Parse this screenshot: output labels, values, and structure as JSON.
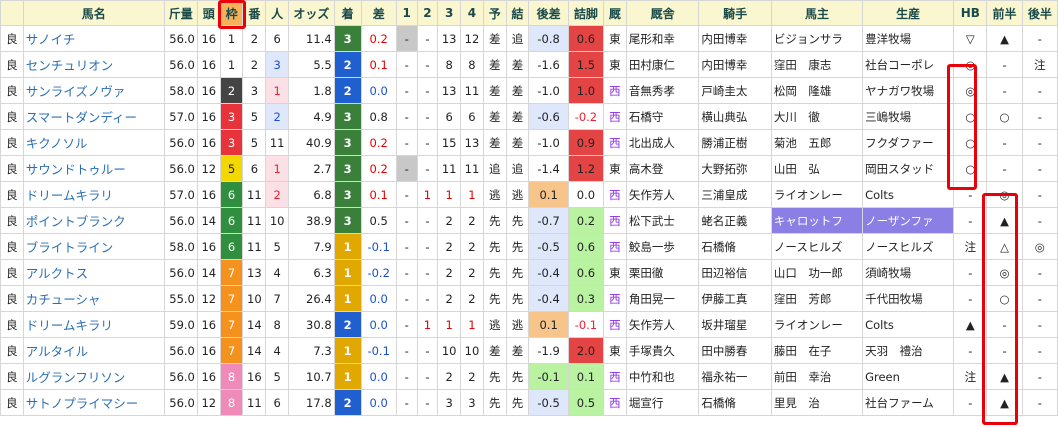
{
  "headers": [
    "",
    "馬名",
    "斤量",
    "頭",
    "枠",
    "番",
    "人",
    "オッズ",
    "着",
    "差",
    "1",
    "2",
    "3",
    "4",
    "予",
    "結",
    "後差",
    "詰脚",
    "厩",
    "厩舎",
    "騎手",
    "馬主",
    "生産",
    "HB",
    "前半",
    "後半"
  ],
  "colors": {
    "waku": {
      "1": "#ffffff",
      "2": "#444444",
      "3": "#e8333a",
      "4": "#2f6fcc",
      "5": "#f3d800",
      "6": "#2f8f3f",
      "7": "#f5921e",
      "8": "#f08ab8"
    },
    "chaku": {
      "1": "#e0a800",
      "2": "#1f5fd0",
      "3": "#3a7f3a",
      "4": "#555555",
      "5": "#b00000",
      "6": "#b00000",
      "7": "#b00000",
      "8": "#b00000",
      "9": "#b00000"
    },
    "pop_pink": "#fbe0e6",
    "pop_blue": "#dfe7fb",
    "go_green": "#b9f3a2",
    "go_orange": "#f7c48a",
    "tsume_red": "#e54444",
    "tsume_green": "#b9f3a2",
    "tsume_orange": "#f7c48a",
    "highlight_owner": "#8b7fe6",
    "header_bg": "#faf7d0"
  },
  "rows": [
    {
      "baba": "良",
      "name": "サノイチ",
      "kin": "56.0",
      "to": "16",
      "waku": "1",
      "ban": "2",
      "pop": "6",
      "popc": "",
      "odds": "11.4",
      "chaku": "3",
      "sa": "0.2",
      "sac": "pos",
      "p1": "-",
      "p1g": true,
      "p2": "-",
      "p3": "13",
      "p4": "12",
      "yo": "差",
      "ketsu": "追",
      "go": "-0.8",
      "goc": "blue",
      "tsume": "0.6",
      "tsumec": "red",
      "ew": "東",
      "stable": "尾形和幸",
      "jockey": "内田博幸",
      "owner": "ビジョンサラ",
      "ownc": "",
      "breeder": "豊洋牧場",
      "breedc": "",
      "hb": "▽",
      "zen": "▲",
      "kou": "-"
    },
    {
      "baba": "良",
      "name": "センチュリオン",
      "kin": "56.0",
      "to": "16",
      "waku": "1",
      "ban": "2",
      "pop": "3",
      "popc": "blue",
      "odds": "5.5",
      "chaku": "2",
      "sa": "0.1",
      "sac": "pos",
      "p1": "-",
      "p1g": false,
      "p2": "-",
      "p3": "8",
      "p4": "8",
      "yo": "差",
      "ketsu": "差",
      "go": "-1.6",
      "goc": "",
      "tsume": "1.5",
      "tsumec": "red",
      "ew": "東",
      "stable": "田村康仁",
      "jockey": "内田博幸",
      "owner": "窪田　康志",
      "ownc": "",
      "breeder": "社台コーポレ",
      "breedc": "",
      "hb": "◎",
      "zen": "-",
      "kou": "注"
    },
    {
      "baba": "良",
      "name": "サンライズノヴァ",
      "kin": "58.0",
      "to": "16",
      "waku": "2",
      "ban": "3",
      "pop": "1",
      "popc": "pink",
      "odds": "1.8",
      "chaku": "2",
      "sa": "0.0",
      "sac": "neg",
      "p1": "-",
      "p1g": false,
      "p2": "-",
      "p3": "13",
      "p4": "11",
      "yo": "差",
      "ketsu": "差",
      "go": "-1.0",
      "goc": "",
      "tsume": "1.0",
      "tsumec": "red",
      "ew": "西",
      "stable": "音無秀孝",
      "jockey": "戸崎圭太",
      "owner": "松岡　隆雄",
      "ownc": "",
      "breeder": "ヤナガワ牧場",
      "breedc": "",
      "hb": "◎",
      "zen": "-",
      "kou": "-"
    },
    {
      "baba": "良",
      "name": "スマートダンディー",
      "kin": "57.0",
      "to": "16",
      "waku": "3",
      "ban": "5",
      "pop": "2",
      "popc": "blue",
      "odds": "4.9",
      "chaku": "3",
      "sa": "0.8",
      "sac": "",
      "p1": "-",
      "p1g": false,
      "p2": "-",
      "p3": "6",
      "p4": "6",
      "yo": "差",
      "ketsu": "差",
      "go": "-0.6",
      "goc": "blue",
      "tsume": "-0.2",
      "tsumec": "",
      "ew": "西",
      "stable": "石橋守",
      "jockey": "横山典弘",
      "owner": "大川　徹",
      "ownc": "",
      "breeder": "三嶋牧場",
      "breedc": "",
      "hb": "○",
      "zen": "○",
      "kou": "-"
    },
    {
      "baba": "良",
      "name": "キクノソル",
      "kin": "56.0",
      "to": "16",
      "waku": "3",
      "ban": "5",
      "pop": "11",
      "popc": "",
      "odds": "40.9",
      "chaku": "3",
      "sa": "0.2",
      "sac": "pos",
      "p1": "-",
      "p1g": false,
      "p2": "-",
      "p3": "15",
      "p4": "13",
      "yo": "差",
      "ketsu": "差",
      "go": "-1.0",
      "goc": "",
      "tsume": "0.9",
      "tsumec": "red",
      "ew": "西",
      "stable": "北出成人",
      "jockey": "勝浦正樹",
      "owner": "菊池　五郎",
      "ownc": "",
      "breeder": "フクダファー",
      "breedc": "",
      "hb": "○",
      "zen": "-",
      "kou": "-"
    },
    {
      "baba": "良",
      "name": "サウンドトゥルー",
      "kin": "56.0",
      "to": "12",
      "waku": "5",
      "ban": "6",
      "pop": "1",
      "popc": "pink",
      "odds": "2.7",
      "chaku": "3",
      "sa": "0.2",
      "sac": "pos",
      "p1": "-",
      "p1g": true,
      "p2": "-",
      "p3": "11",
      "p4": "11",
      "yo": "追",
      "ketsu": "追",
      "go": "-1.4",
      "goc": "",
      "tsume": "1.2",
      "tsumec": "red",
      "ew": "東",
      "stable": "高木登",
      "jockey": "大野拓弥",
      "owner": "山田　弘",
      "ownc": "",
      "breeder": "岡田スタッド",
      "breedc": "",
      "hb": "○",
      "zen": "-",
      "kou": "-"
    },
    {
      "baba": "良",
      "name": "ドリームキラリ",
      "kin": "57.0",
      "to": "16",
      "waku": "6",
      "ban": "11",
      "pop": "2",
      "popc": "pink",
      "odds": "6.8",
      "chaku": "3",
      "sa": "0.1",
      "sac": "pos",
      "p1": "-",
      "p1g": false,
      "p2": "1",
      "p3": "1",
      "p4": "1",
      "yo": "逃",
      "ketsu": "逃",
      "go": "0.1",
      "goc": "orange",
      "tsume": "0.0",
      "tsumec": "",
      "ew": "西",
      "stable": "矢作芳人",
      "jockey": "三浦皇成",
      "owner": "ライオンレー",
      "ownc": "",
      "breeder": "Colts",
      "breedc": "",
      "hb": "-",
      "zen": "◎",
      "kou": "-"
    },
    {
      "baba": "良",
      "name": "ポイントブランク",
      "kin": "56.0",
      "to": "14",
      "waku": "6",
      "ban": "11",
      "pop": "10",
      "popc": "",
      "odds": "38.9",
      "chaku": "3",
      "sa": "0.5",
      "sac": "",
      "p1": "-",
      "p1g": false,
      "p2": "-",
      "p3": "2",
      "p4": "2",
      "yo": "先",
      "ketsu": "先",
      "go": "-0.7",
      "goc": "blue",
      "tsume": "0.2",
      "tsumec": "green",
      "ew": "西",
      "stable": "松下武士",
      "jockey": "蛯名正義",
      "owner": "キャロットフ",
      "ownc": "hl",
      "breeder": "ノーザンファ",
      "breedc": "hl",
      "hb": "-",
      "zen": "▲",
      "kou": "-"
    },
    {
      "baba": "良",
      "name": "ブライトライン",
      "kin": "58.0",
      "to": "16",
      "waku": "6",
      "ban": "11",
      "pop": "5",
      "popc": "",
      "odds": "7.9",
      "chaku": "1",
      "sa": "-0.1",
      "sac": "neg",
      "p1": "-",
      "p1g": false,
      "p2": "-",
      "p3": "2",
      "p4": "2",
      "yo": "先",
      "ketsu": "先",
      "go": "-0.5",
      "goc": "blue",
      "tsume": "0.6",
      "tsumec": "green",
      "ew": "西",
      "stable": "鮫島一歩",
      "jockey": "石橋脩",
      "owner": "ノースヒルズ",
      "ownc": "",
      "breeder": "ノースヒルズ",
      "breedc": "",
      "hb": "注",
      "zen": "△",
      "kou": "◎"
    },
    {
      "baba": "良",
      "name": "アルクトス",
      "kin": "56.0",
      "to": "14",
      "waku": "7",
      "ban": "13",
      "pop": "4",
      "popc": "",
      "odds": "6.3",
      "chaku": "1",
      "sa": "-0.2",
      "sac": "neg",
      "p1": "-",
      "p1g": false,
      "p2": "-",
      "p3": "2",
      "p4": "2",
      "yo": "先",
      "ketsu": "先",
      "go": "-0.4",
      "goc": "blue",
      "tsume": "0.6",
      "tsumec": "green",
      "ew": "東",
      "stable": "栗田徹",
      "jockey": "田辺裕信",
      "owner": "山口　功一郎",
      "ownc": "",
      "breeder": "須崎牧場",
      "breedc": "",
      "hb": "-",
      "zen": "◎",
      "kou": "-"
    },
    {
      "baba": "良",
      "name": "カチューシャ",
      "kin": "55.0",
      "to": "12",
      "waku": "7",
      "ban": "10",
      "pop": "7",
      "popc": "",
      "odds": "26.4",
      "chaku": "1",
      "sa": "0.0",
      "sac": "neg",
      "p1": "-",
      "p1g": false,
      "p2": "-",
      "p3": "2",
      "p4": "2",
      "yo": "先",
      "ketsu": "先",
      "go": "-0.4",
      "goc": "blue",
      "tsume": "0.3",
      "tsumec": "green",
      "ew": "西",
      "stable": "角田晃一",
      "jockey": "伊藤工真",
      "owner": "窪田　芳郎",
      "ownc": "",
      "breeder": "千代田牧場",
      "breedc": "",
      "hb": "-",
      "zen": "○",
      "kou": "-"
    },
    {
      "baba": "良",
      "name": "ドリームキラリ",
      "kin": "59.0",
      "to": "16",
      "waku": "7",
      "ban": "14",
      "pop": "8",
      "popc": "",
      "odds": "30.8",
      "chaku": "2",
      "sa": "0.0",
      "sac": "neg",
      "p1": "-",
      "p1g": false,
      "p2": "1",
      "p3": "1",
      "p4": "1",
      "yo": "逃",
      "ketsu": "逃",
      "go": "0.1",
      "goc": "orange",
      "tsume": "-0.1",
      "tsumec": "",
      "ew": "西",
      "stable": "矢作芳人",
      "jockey": "坂井瑠星",
      "owner": "ライオンレー",
      "ownc": "",
      "breeder": "Colts",
      "breedc": "",
      "hb": "▲",
      "zen": "-",
      "kou": "-"
    },
    {
      "baba": "良",
      "name": "アルタイル",
      "kin": "56.0",
      "to": "16",
      "waku": "7",
      "ban": "14",
      "pop": "4",
      "popc": "",
      "odds": "7.3",
      "chaku": "1",
      "sa": "-0.1",
      "sac": "neg",
      "p1": "-",
      "p1g": false,
      "p2": "-",
      "p3": "10",
      "p4": "10",
      "yo": "差",
      "ketsu": "差",
      "go": "-1.9",
      "goc": "",
      "tsume": "2.0",
      "tsumec": "red",
      "ew": "東",
      "stable": "手塚貴久",
      "jockey": "田中勝春",
      "owner": "藤田　在子",
      "ownc": "",
      "breeder": "天羽　禮治",
      "breedc": "",
      "hb": "-",
      "zen": "-",
      "kou": "-"
    },
    {
      "baba": "良",
      "name": "ルグランフリソン",
      "kin": "56.0",
      "to": "16",
      "waku": "8",
      "ban": "16",
      "pop": "5",
      "popc": "",
      "odds": "10.7",
      "chaku": "1",
      "sa": "0.0",
      "sac": "neg",
      "p1": "-",
      "p1g": false,
      "p2": "-",
      "p3": "2",
      "p4": "2",
      "yo": "先",
      "ketsu": "先",
      "go": "-0.1",
      "goc": "green",
      "tsume": "0.1",
      "tsumec": "green",
      "ew": "西",
      "stable": "中竹和也",
      "jockey": "福永祐一",
      "owner": "前田　幸治",
      "ownc": "",
      "breeder": "Green",
      "breedc": "",
      "hb": "注",
      "zen": "▲",
      "kou": "-"
    },
    {
      "baba": "良",
      "name": "サトノプライマシー",
      "kin": "56.0",
      "to": "12",
      "waku": "8",
      "ban": "11",
      "pop": "6",
      "popc": "",
      "odds": "17.8",
      "chaku": "2",
      "sa": "0.0",
      "sac": "neg",
      "p1": "-",
      "p1g": false,
      "p2": "-",
      "p3": "3",
      "p4": "3",
      "yo": "先",
      "ketsu": "先",
      "go": "-0.5",
      "goc": "blue",
      "tsume": "0.5",
      "tsumec": "green",
      "ew": "西",
      "stable": "堀宣行",
      "jockey": "石橋脩",
      "owner": "里見　治",
      "ownc": "",
      "breeder": "社台ファーム",
      "breedc": "",
      "hb": "-",
      "zen": "▲",
      "kou": "-"
    }
  ]
}
